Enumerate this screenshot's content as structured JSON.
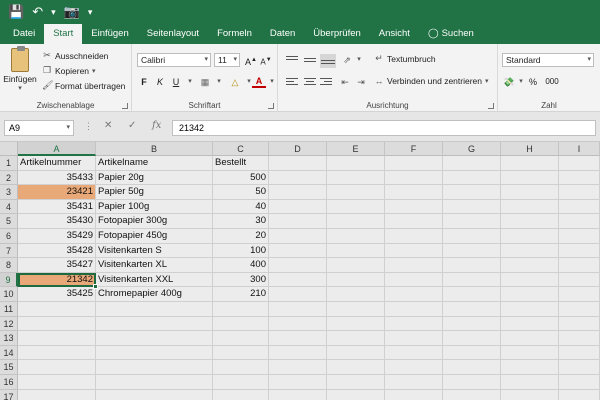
{
  "quick_access": {
    "save_icon": "save-icon",
    "undo_icon": "undo-icon",
    "camera_icon": "camera-icon"
  },
  "tabs": [
    {
      "label": "Datei",
      "active": false
    },
    {
      "label": "Start",
      "active": true
    },
    {
      "label": "Einfügen",
      "active": false
    },
    {
      "label": "Seitenlayout",
      "active": false
    },
    {
      "label": "Formeln",
      "active": false
    },
    {
      "label": "Daten",
      "active": false
    },
    {
      "label": "Überprüfen",
      "active": false
    },
    {
      "label": "Ansicht",
      "active": false
    }
  ],
  "search": {
    "label": "Suchen"
  },
  "ribbon": {
    "clipboard": {
      "paste_label": "Einfügen",
      "cut_label": "Ausschneiden",
      "copy_label": "Kopieren",
      "format_painter_label": "Format übertragen",
      "group_label": "Zwischenablage"
    },
    "font": {
      "font_name": "Calibri",
      "font_size": "11",
      "bold": "F",
      "italic": "K",
      "underline": "U",
      "grow_label": "A",
      "shrink_label": "A",
      "font_color_label": "A",
      "group_label": "Schriftart"
    },
    "alignment": {
      "wrap_label": "Textumbruch",
      "merge_label": "Verbinden und zentrieren",
      "group_label": "Ausrichtung"
    },
    "number": {
      "format": "Standard",
      "percent": "%",
      "thousands": "000",
      "currency_icon": "currency-icon",
      "group_label": "Zahl"
    }
  },
  "formula_bar": {
    "name_box": "A9",
    "fx_label": "fx",
    "value": "21342"
  },
  "sheet": {
    "columns": [
      "A",
      "B",
      "C",
      "D",
      "E",
      "F",
      "G",
      "H",
      "I"
    ],
    "row_numbers": [
      "1",
      "2",
      "3",
      "4",
      "5",
      "6",
      "7",
      "8",
      "9",
      "10",
      "11",
      "12",
      "13",
      "14",
      "15",
      "16",
      "17"
    ],
    "header": [
      "Artikelnummer",
      "Artikelname",
      "Bestellt"
    ],
    "rows": [
      [
        "35433",
        "Papier 20g",
        "500"
      ],
      [
        "23421",
        "Papier 50g",
        "50"
      ],
      [
        "35431",
        "Papier 100g",
        "40"
      ],
      [
        "35430",
        "Fotopapier 300g",
        "30"
      ],
      [
        "35429",
        "Fotopapier 450g",
        "20"
      ],
      [
        "35428",
        "Visitenkarten S",
        "100"
      ],
      [
        "35427",
        "Visitenkarten XL",
        "400"
      ],
      [
        "21342",
        "Visitenkarten XXL",
        "300"
      ],
      [
        "35425",
        "Chromepapier 400g",
        "210"
      ]
    ],
    "highlighted_rows": [
      3,
      9
    ],
    "active_cell": "A9",
    "highlight_color": "#e8a878",
    "accent_color": "#217346"
  }
}
